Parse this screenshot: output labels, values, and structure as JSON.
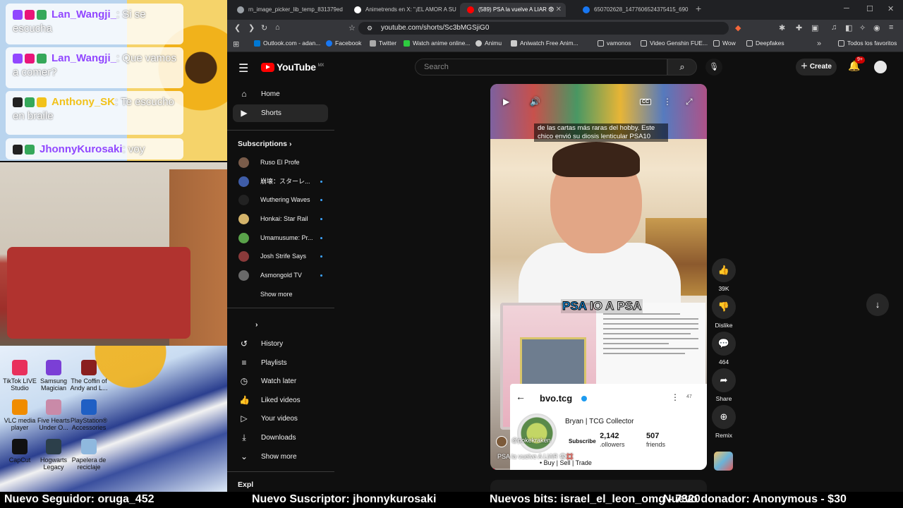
{
  "stream_overlay": {
    "chat": [
      {
        "user": "Lan_Wangji_",
        "message": ": Si se escucha",
        "user_color": "#9147ff"
      },
      {
        "user": "Lan_Wangji_",
        "message": ": Que vamos a comer?",
        "user_color": "#9147ff"
      },
      {
        "user": "Anthony_SK",
        "message": ": Te escucho en braile",
        "user_color": "#f2c21b"
      },
      {
        "user": "JhonnyKurosaki",
        "message": ": voy",
        "user_color": "#9147ff"
      }
    ],
    "desktop_icons": [
      {
        "label": "TikTok LIVE Studio",
        "color": "#e8305c"
      },
      {
        "label": "Samsung Magician",
        "color": "#7b3fd6"
      },
      {
        "label": "The Coffin of Andy and L...",
        "color": "#8a1f1f"
      },
      {
        "label": "VLC media player",
        "color": "#f08c00"
      },
      {
        "label": "Five Hearts Under O...",
        "color": "#c98aa8"
      },
      {
        "label": "PlayStation® Accessories",
        "color": "#1f5fc4"
      },
      {
        "label": "CapCut",
        "color": "#111111"
      },
      {
        "label": "Hogwarts Legacy",
        "color": "#2c3f4a"
      },
      {
        "label": "Papelera de reciclaje",
        "color": "#8fb8de"
      }
    ]
  },
  "browser": {
    "tabs": [
      {
        "title": "rn_image_picker_lib_temp_831379ed",
        "favicon_color": "#9aa0a6",
        "active": false
      },
      {
        "title": "Animetrends en X: \"¡EL AMOR A SU",
        "favicon_color": "#ffffff",
        "active": false
      },
      {
        "title": "(589) PSA la vuelve A LIAR 😨",
        "favicon_color": "#ff0000",
        "active": true
      },
      {
        "title": "650702628_1477606524375415_690",
        "favicon_color": "#1877f2",
        "active": false
      }
    ],
    "new_tab": "+",
    "url": "youtube.com/shorts/Sc3bMGSjiG0",
    "bookmarks": [
      {
        "label": "Outlook.com - adan...",
        "color": "#0078d4"
      },
      {
        "label": "Facebook",
        "color": "#1877f2"
      },
      {
        "label": "Twitter",
        "color": "#aaaaaa"
      },
      {
        "label": "Watch anime online...",
        "color": "#2ecc40"
      },
      {
        "label": "Animu",
        "color": "#cccccc"
      },
      {
        "label": "Aniwatch Free Anim...",
        "color": "#cccccc"
      },
      {
        "label": "vamonos",
        "color": "#cccccc"
      },
      {
        "label": "Video Genshin FUE...",
        "color": "#cccccc"
      },
      {
        "label": "Wow",
        "color": "#cccccc"
      },
      {
        "label": "Deepfakes",
        "color": "#cccccc"
      },
      {
        "label": "Todos los favoritos",
        "color": "#cccccc"
      }
    ]
  },
  "youtube": {
    "logo_text": "YouTube",
    "region": "MX",
    "search_placeholder": "Search",
    "create_label": "Create",
    "notifications": "9+",
    "sidebar": {
      "main": [
        {
          "label": "Home",
          "icon": "home-icon"
        },
        {
          "label": "Shorts",
          "icon": "shorts-icon"
        }
      ],
      "subscriptions_title": "Subscriptions",
      "subscriptions": [
        {
          "label": "Ruso El Profe",
          "dot": false,
          "color": "#7a5c4a"
        },
        {
          "label": "崩壊：スターレ...",
          "dot": true,
          "color": "#3f5da8"
        },
        {
          "label": "Wuthering Waves",
          "dot": true,
          "color": "#222222"
        },
        {
          "label": "Honkai: Star Rail",
          "dot": true,
          "color": "#d4b36a"
        },
        {
          "label": "Umamusume: Pr...",
          "dot": true,
          "color": "#5aa24a"
        },
        {
          "label": "Josh Strife Says",
          "dot": true,
          "color": "#8a3a3a"
        },
        {
          "label": "Asmongold TV",
          "dot": true,
          "color": "#6a6a6a"
        }
      ],
      "show_more": "Show more",
      "you": [
        {
          "label": "History",
          "icon": "history-icon"
        },
        {
          "label": "Playlists",
          "icon": "playlists-icon"
        },
        {
          "label": "Watch later",
          "icon": "watch-later-icon"
        },
        {
          "label": "Liked videos",
          "icon": "liked-videos-icon"
        },
        {
          "label": "Your videos",
          "icon": "your-videos-icon"
        },
        {
          "label": "Downloads",
          "icon": "downloads-icon"
        }
      ],
      "show_more_2": "Show more",
      "explore_partial": "Expl"
    },
    "short": {
      "caption": "de las cartas más raras del hobby. Este chico envió su diosis lenticular PSA10",
      "overlay_text_blue": "PSA",
      "overlay_text_white": "IO A PSA",
      "profile": {
        "handle": "bvo.tcg",
        "name": "Bryan | TCG Collector",
        "followers_count": "2,142",
        "followers_label": "followers",
        "friends_count": "507",
        "friends_label": "friends",
        "bio": "• Buy | Sell | Trade",
        "posts_count": "47"
      },
      "channel": "@pokekraken",
      "subscribe_label": "Subscribe",
      "title": "PSA la vuelve A LIAR 😨💢",
      "progress": 0.02
    },
    "actions": {
      "likes": "39K",
      "dislike_label": "Dislike",
      "comments": "464",
      "share_label": "Share",
      "remix_label": "Remix"
    }
  },
  "ticker": [
    "Nuevo Seguidor: oruga_452",
    "Nuevo Suscriptor: jhonnykurosaki",
    "Nuevos bits: israel_el_leon_omg - 7320",
    "Nuevo donador: Anonymous - $30"
  ]
}
